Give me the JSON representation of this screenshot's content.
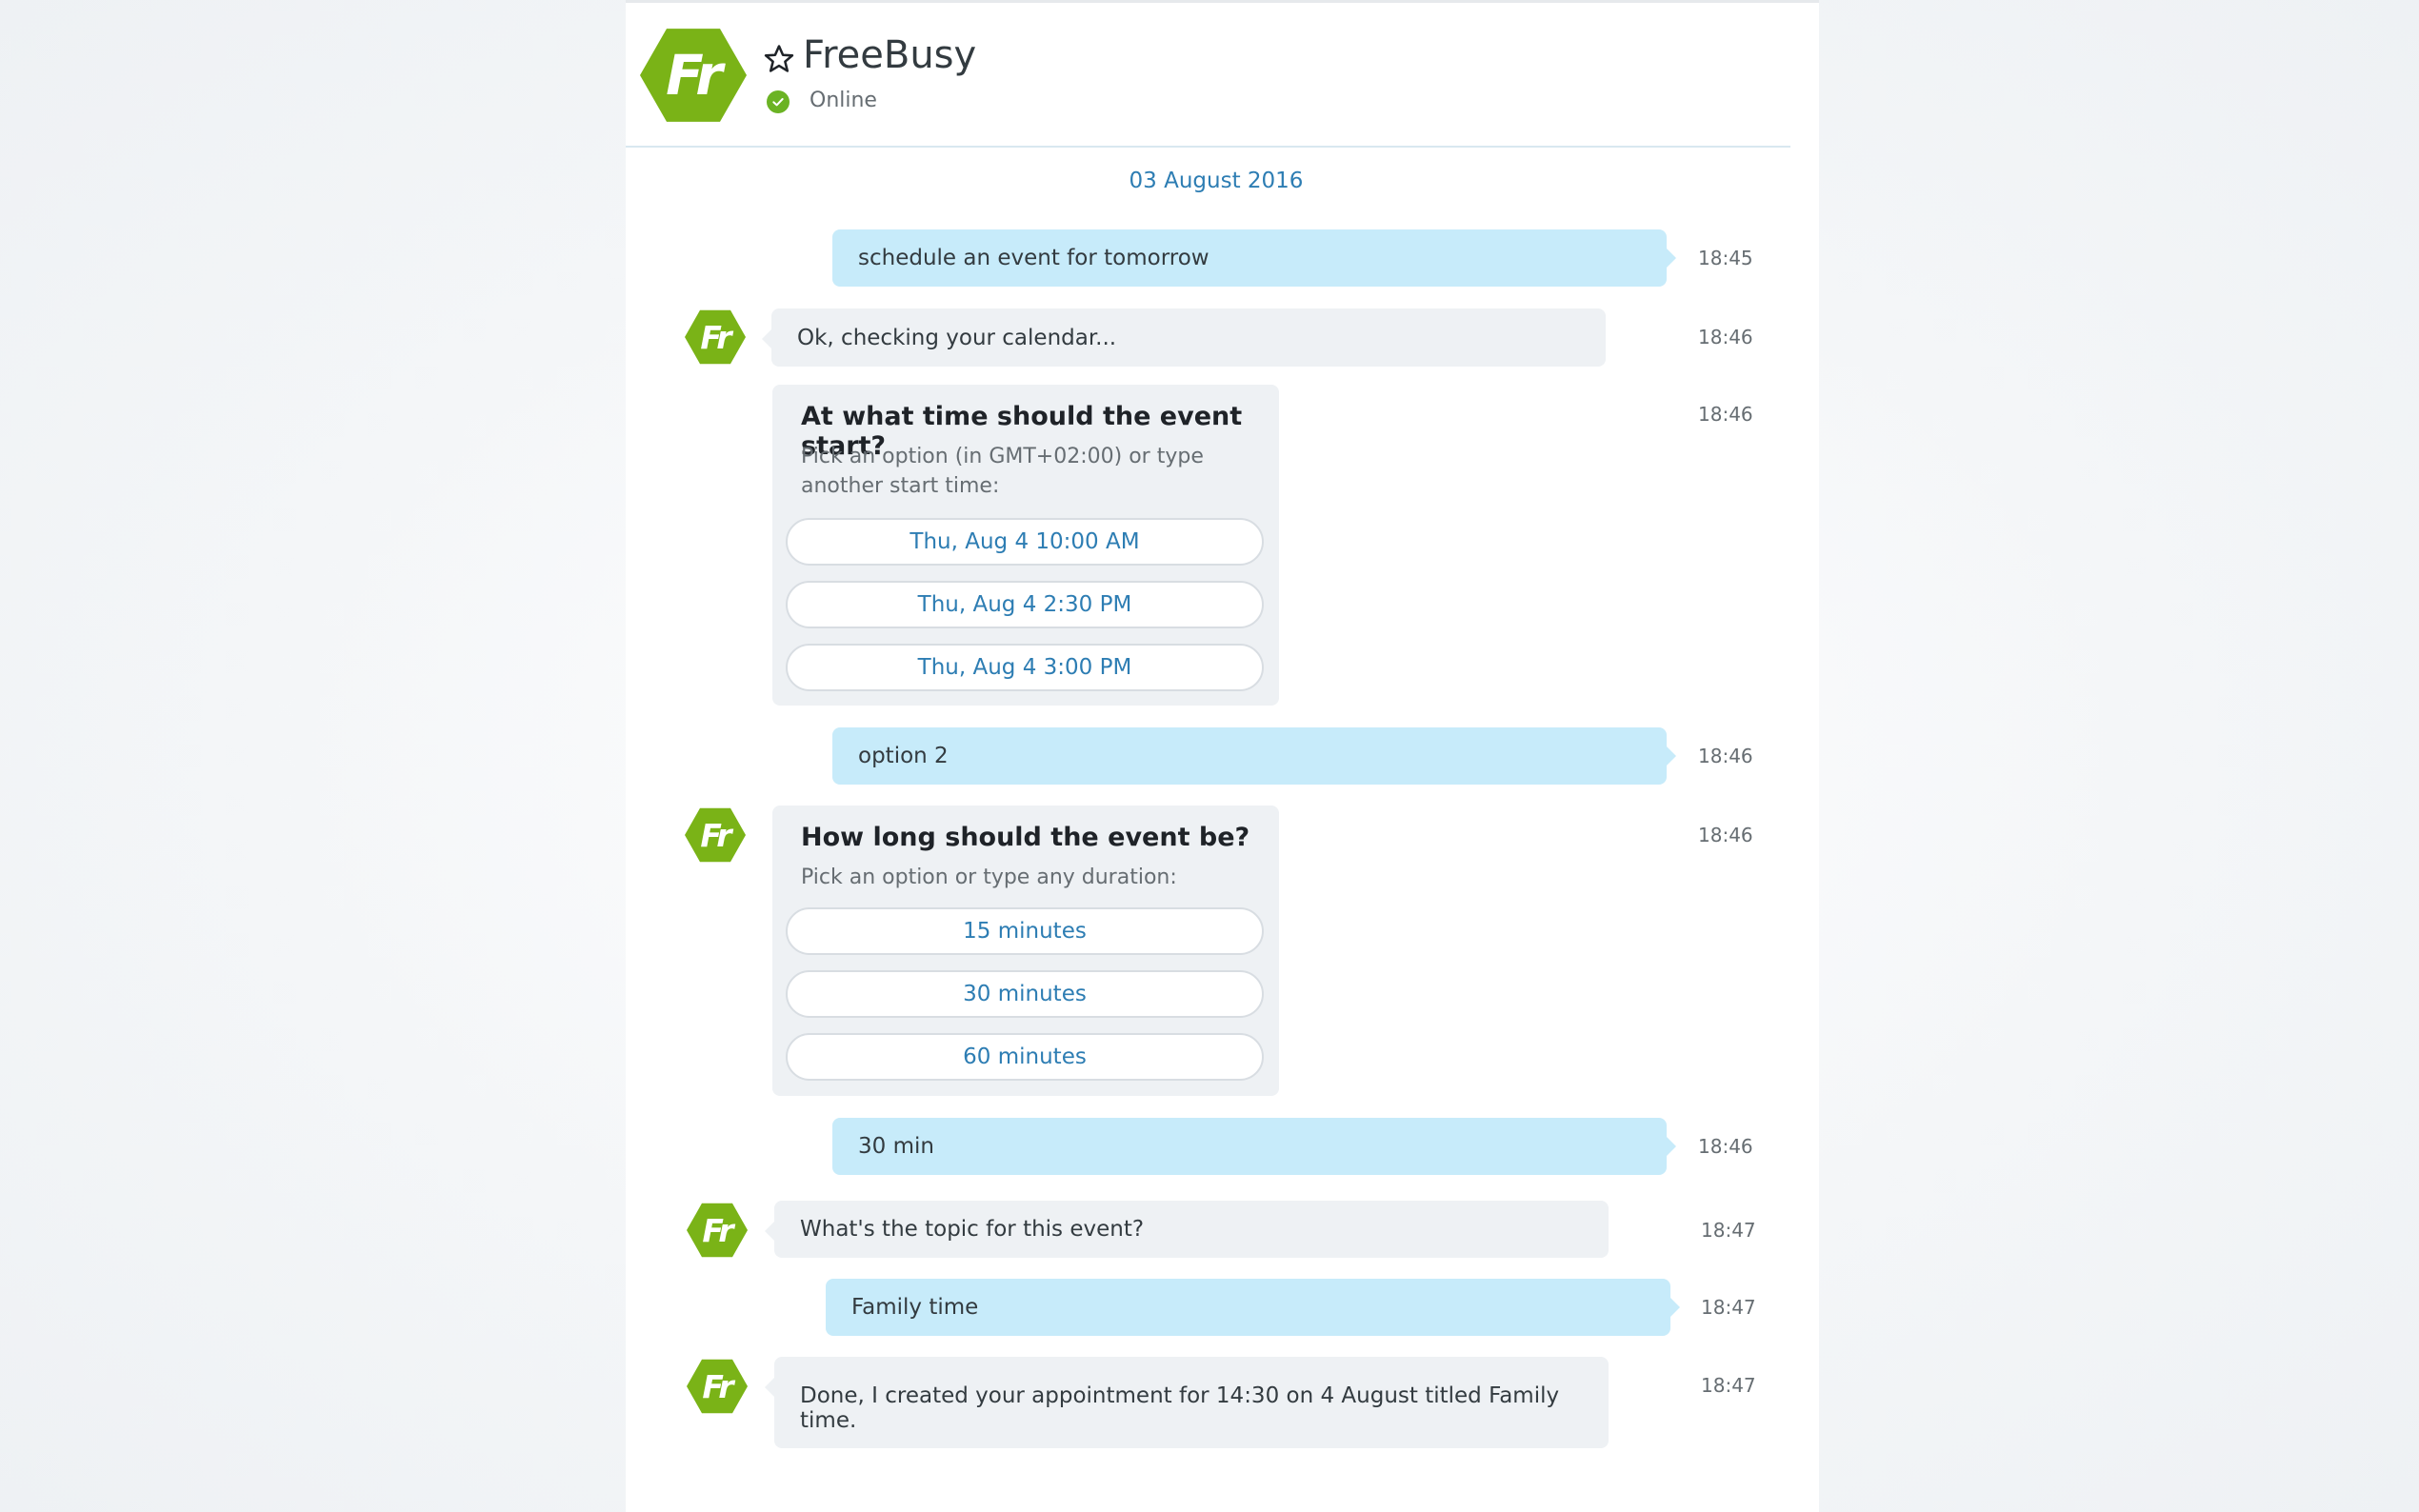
{
  "header": {
    "logo_text": "Fr",
    "title": "FreeBusy",
    "status": "Online"
  },
  "conversation": {
    "date": "03 August 2016",
    "messages": [
      {
        "text": "schedule an event for tomorrow",
        "time": "18:45"
      },
      {
        "text": "Ok, checking your calendar...",
        "time": "18:46"
      },
      {
        "time": "18:46"
      },
      {
        "text": "option 2",
        "time": "18:46"
      },
      {
        "time": "18:46"
      },
      {
        "text": "30 min",
        "time": "18:46"
      },
      {
        "text": "What's the topic for this event?",
        "time": "18:47"
      },
      {
        "text": "Family time",
        "time": "18:47"
      },
      {
        "text": "Done, I created your appointment for 14:30 on 4 August titled Family time.",
        "time": "18:47"
      }
    ]
  },
  "cards": {
    "start_time": {
      "question": "At what time should the event start?",
      "subtitle": "Pick an option (in GMT+02:00) or type another start time:",
      "options": [
        "Thu, Aug 4 10:00 AM",
        "Thu, Aug 4 2:30 PM",
        "Thu, Aug 4 3:00 PM"
      ]
    },
    "duration": {
      "question": "How long should the event be?",
      "subtitle": "Pick an option or type any duration:",
      "options": [
        "15 minutes",
        "30 minutes",
        "60 minutes"
      ]
    }
  },
  "colors": {
    "brand": "#7ab317",
    "online": "#6bb324",
    "outgoing_bubble": "#c7ebfa",
    "incoming_bubble": "#eef1f4",
    "link": "#2d7db3"
  },
  "icons": {
    "favorite": "star-outline-icon",
    "status": "check-circle-icon",
    "bot_avatar": "freebusy-logo"
  }
}
